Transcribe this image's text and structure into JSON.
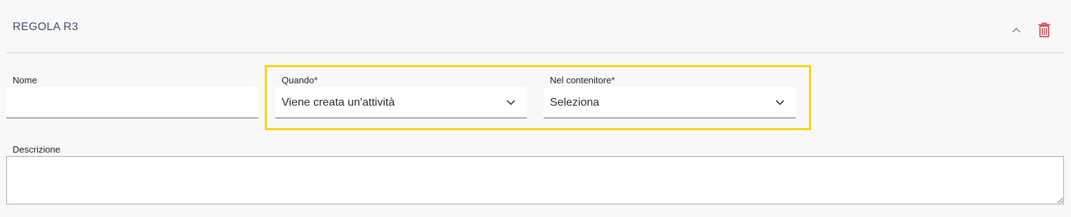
{
  "rule": {
    "title": "REGOLA R3"
  },
  "icons": {
    "collapse": "chevron-up-icon",
    "delete": "trash-icon"
  },
  "colors": {
    "title": "#3c4a63",
    "delete_icon": "#c8323c",
    "highlight_border": "#f5d60f",
    "background": "#f8f8f8"
  },
  "form": {
    "nome": {
      "label": "Nome",
      "value": ""
    },
    "quando": {
      "label": "Quando*",
      "selected": "Viene creata un'attività"
    },
    "contenitore": {
      "label": "Nel contenitore*",
      "selected": "Seleziona"
    },
    "descrizione": {
      "label": "Descrizione",
      "value": ""
    }
  }
}
